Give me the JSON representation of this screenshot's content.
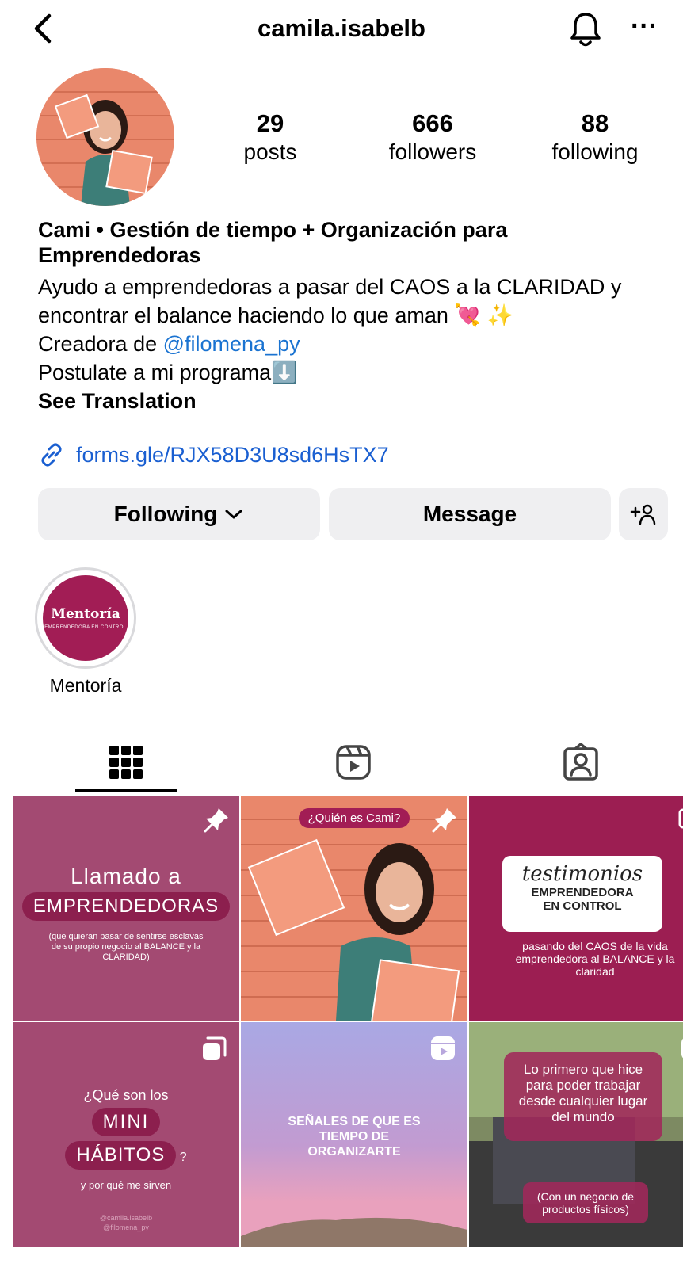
{
  "header": {
    "username": "camila.isabelb",
    "more_label": "···"
  },
  "stats": {
    "posts": {
      "value": "29",
      "label": "posts"
    },
    "followers": {
      "value": "666",
      "label": "followers"
    },
    "following": {
      "value": "88",
      "label": "following"
    }
  },
  "bio": {
    "name_line1": "Cami • Gestión de tiempo + Organización para",
    "name_line2": "Emprendedoras",
    "line1": "Ayudo a emprendedoras a pasar del CAOS a la CLARIDAD y",
    "line2": "encontrar el balance haciendo lo que aman 💘 ✨",
    "line3_prefix": "Creadora de ",
    "line3_mention": "@filomena_py",
    "line4": "Postulate a mi programa⬇️",
    "see_translation": "See Translation",
    "link": "forms.gle/RJX58D3U8sd6HsTX7"
  },
  "actions": {
    "following": "Following",
    "message": "Message"
  },
  "highlights": [
    {
      "label": "Mentoría",
      "cover_title": "Mentoría",
      "cover_subtitle": "EMPRENDEDORA EN CONTROL"
    }
  ],
  "grid": {
    "tile1": {
      "line1": "Llamado a",
      "pill": "EMPRENDEDORAS",
      "small": "(que quieran pasar de sentirse esclavas de su propio negocio al BALANCE y la CLARIDAD)"
    },
    "tile2": {
      "pill": "¿Quién es Cami?"
    },
    "tile3": {
      "script": "testimonios",
      "line1": "EMPRENDEDORA",
      "line2": "EN CONTROL",
      "caption": "pasando del CAOS de la vida emprendedora al BALANCE y la claridad"
    },
    "tile4": {
      "line1": "¿Qué son los",
      "pill1": "MINI",
      "pill2": "HÁBITOS",
      "q": "?",
      "line2": "y por qué me sirven",
      "handle1": "@camila.isabelb",
      "handle2": "@filomena_py"
    },
    "tile5": {
      "text": "SEÑALES DE QUE ES TIEMPO DE ORGANIZARTE"
    },
    "tile6": {
      "text": "Lo primero que hice para poder trabajar desde cualquier lugar del mundo",
      "caption": "(Con un negocio de productos físicos)"
    }
  },
  "colors": {
    "link_blue": "#1a73d1",
    "button_bg": "#efeff1",
    "brand_magenta": "#a21d55",
    "tile_mauve": "#a34a72"
  }
}
